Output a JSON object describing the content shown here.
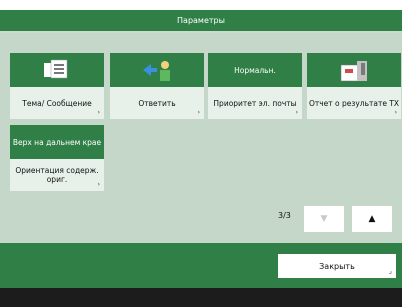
{
  "title": "Параметры",
  "tiles": [
    {
      "label": "Тема/ Сообщение",
      "icon": "document-icon"
    },
    {
      "label": "Ответить",
      "icon": "reply-person-icon"
    },
    {
      "top_text": "Нормальн.",
      "label": "Приоритет эл. почты"
    },
    {
      "label": "Отчет о результате TX",
      "icon": "report-icon"
    },
    {
      "top_text": "Верх на дальнем крае",
      "label": "Ориентация содерж. ориг."
    }
  ],
  "pager": {
    "indicator": "3/3",
    "prev_icon": "triangle-down",
    "next_icon": "triangle-up"
  },
  "close_label": "Закрыть",
  "colors": {
    "accent": "#2f7f47",
    "panel": "#c4d7c9",
    "tile_bg": "#e7f1e9"
  }
}
